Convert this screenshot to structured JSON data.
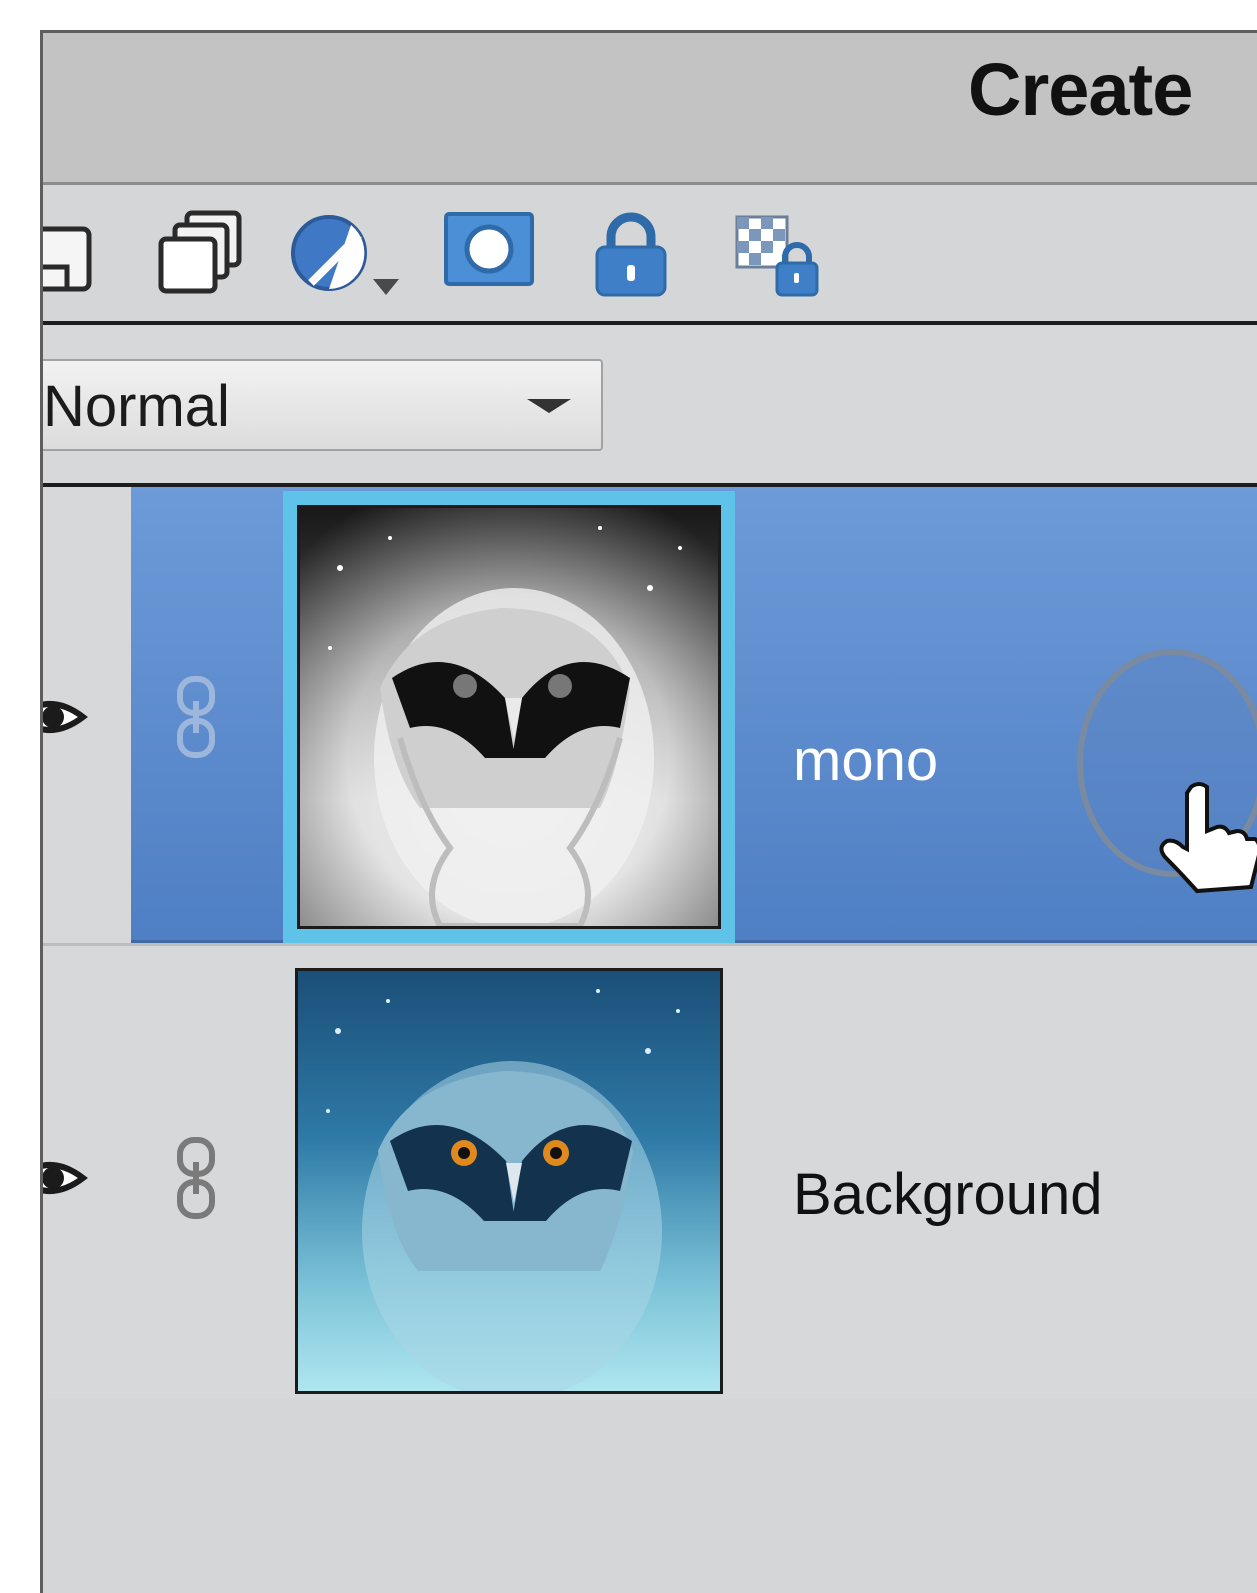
{
  "window": {
    "title": "Create"
  },
  "toolbar": {
    "icons": [
      "new-layer-icon",
      "duplicate-layers-icon",
      "adjustment-layer-icon",
      "layer-mask-icon",
      "lock-icon",
      "lock-transparency-icon"
    ]
  },
  "blend_mode": {
    "selected": "Normal"
  },
  "layers": [
    {
      "name": "mono",
      "selected": true,
      "thumbnail": "grayscale owl thumbnail"
    },
    {
      "name": "Background",
      "selected": false,
      "thumbnail": "blue owl thumbnail"
    }
  ],
  "colors": {
    "selection": "#5b8bd0",
    "selection_border": "#5fc2e8",
    "panel_bg": "#d4d6d7",
    "titlebar_bg": "#c3c3c3"
  }
}
